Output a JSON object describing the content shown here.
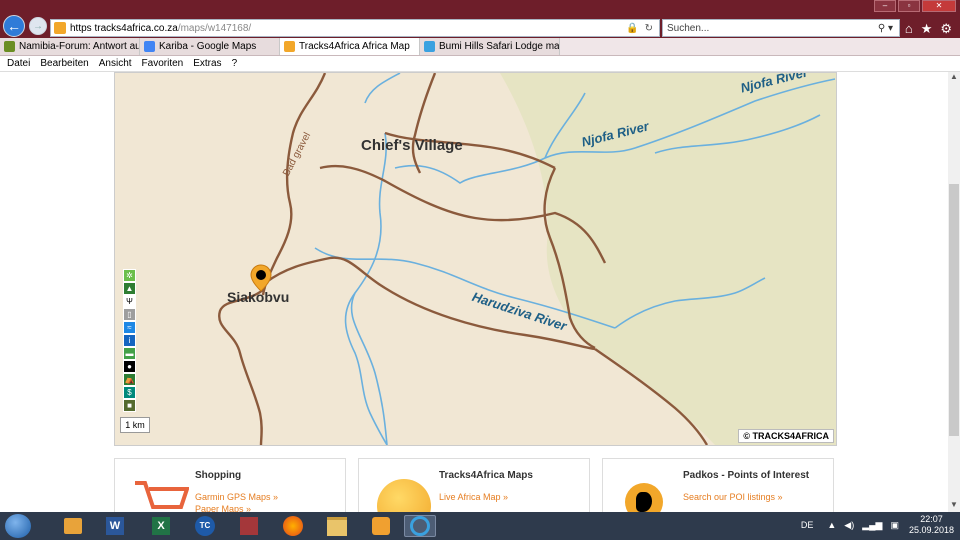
{
  "browser": {
    "url_host": "https  tracks4africa.co.za",
    "url_path": "/maps/w147168/",
    "search_placeholder": "Suchen...",
    "tabs": [
      {
        "label": "Namibia-Forum: Antwort auf ...",
        "icon": "forum-icon",
        "color": "#6b8e23"
      },
      {
        "label": "Kariba - Google Maps",
        "icon": "google-icon",
        "color": "#4285f4"
      },
      {
        "label": "Tracks4Africa Africa Map",
        "icon": "tracks4africa-icon",
        "color": "#f2a72a"
      },
      {
        "label": "Bumi Hills Safari Lodge map | ...",
        "icon": "ie-icon",
        "color": "#3aa1e0"
      }
    ],
    "menu": [
      "Datei",
      "Bearbeiten",
      "Ansicht",
      "Favoriten",
      "Extras",
      "?"
    ]
  },
  "map": {
    "labels": {
      "chiefs_village": "Chief's Village",
      "siakobvu": "Siakobvu",
      "njofa_river_1": "Njofa River",
      "njofa_river_2": "Njofa River",
      "harudziva_river": "Harudziva River",
      "bad_gravel": "Bad gravel"
    },
    "scale": "1 km",
    "copyright": "© TRACKS4AFRICA",
    "colors": {
      "land": "#f1e7d4",
      "park": "#e8e6c8",
      "road": "#8b5a3c",
      "river": "#6ab0de"
    }
  },
  "cards": [
    {
      "title": "Shopping",
      "links": [
        "Garmin GPS Maps »",
        "Paper Maps »"
      ],
      "icon": "cart-icon"
    },
    {
      "title": "Tracks4Africa Maps",
      "links": [
        "Live Africa Map »"
      ],
      "icon": "globe-icon"
    },
    {
      "title": "Padkos - Points of Interest",
      "links": [
        "Search our POI listings »"
      ],
      "icon": "africa-pin-icon"
    }
  ],
  "taskbar": {
    "language": "DE",
    "time": "22:07",
    "date": "25.09.2018"
  }
}
